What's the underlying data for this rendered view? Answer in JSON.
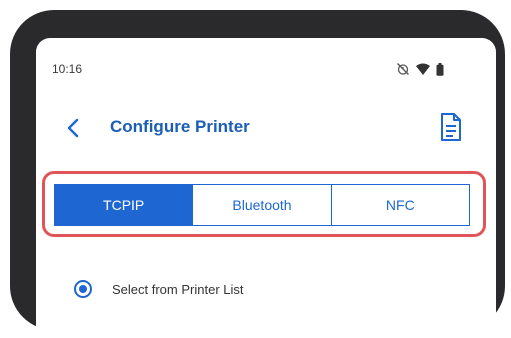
{
  "status_bar": {
    "time": "10:16",
    "icons": [
      "alarm-off-icon",
      "wifi-icon",
      "battery-icon"
    ]
  },
  "app_bar": {
    "title": "Configure Printer",
    "back_icon": "back-chevron-icon",
    "action_icon": "document-icon"
  },
  "tabs": [
    {
      "label": "TCPIP",
      "active": true
    },
    {
      "label": "Bluetooth",
      "active": false
    },
    {
      "label": "NFC",
      "active": false
    }
  ],
  "options": {
    "select_from_list": {
      "label": "Select from Printer List",
      "selected": true
    }
  },
  "colors": {
    "accent": "#1e66d2",
    "title": "#1a5fb4",
    "highlight": "#e0555a",
    "device_frame": "#2a2a2c"
  }
}
